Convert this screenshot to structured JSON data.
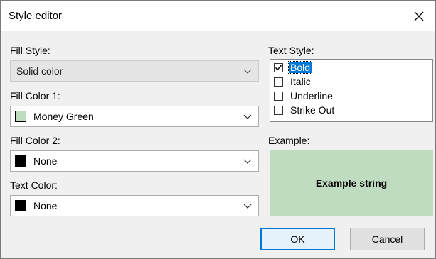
{
  "window": {
    "title": "Style editor"
  },
  "fill_style": {
    "label": "Fill Style:",
    "value": "Solid color"
  },
  "fill_color1": {
    "label": "Fill Color 1:",
    "value": "Money Green",
    "swatch": "#c0dcc0"
  },
  "fill_color2": {
    "label": "Fill Color 2:",
    "value": "None",
    "swatch": "#000000"
  },
  "text_color": {
    "label": "Text Color:",
    "value": "None",
    "swatch": "#000000"
  },
  "text_style": {
    "label": "Text Style:",
    "items": [
      {
        "label": "Bold",
        "checked": true,
        "selected": true
      },
      {
        "label": "Italic",
        "checked": false,
        "selected": false
      },
      {
        "label": "Underline",
        "checked": false,
        "selected": false
      },
      {
        "label": "Strike Out",
        "checked": false,
        "selected": false
      }
    ]
  },
  "example": {
    "label": "Example:",
    "text": "Example string",
    "background": "#c0dcc0"
  },
  "buttons": {
    "ok": "OK",
    "cancel": "Cancel"
  },
  "colors": {
    "accent": "#0078d7"
  }
}
